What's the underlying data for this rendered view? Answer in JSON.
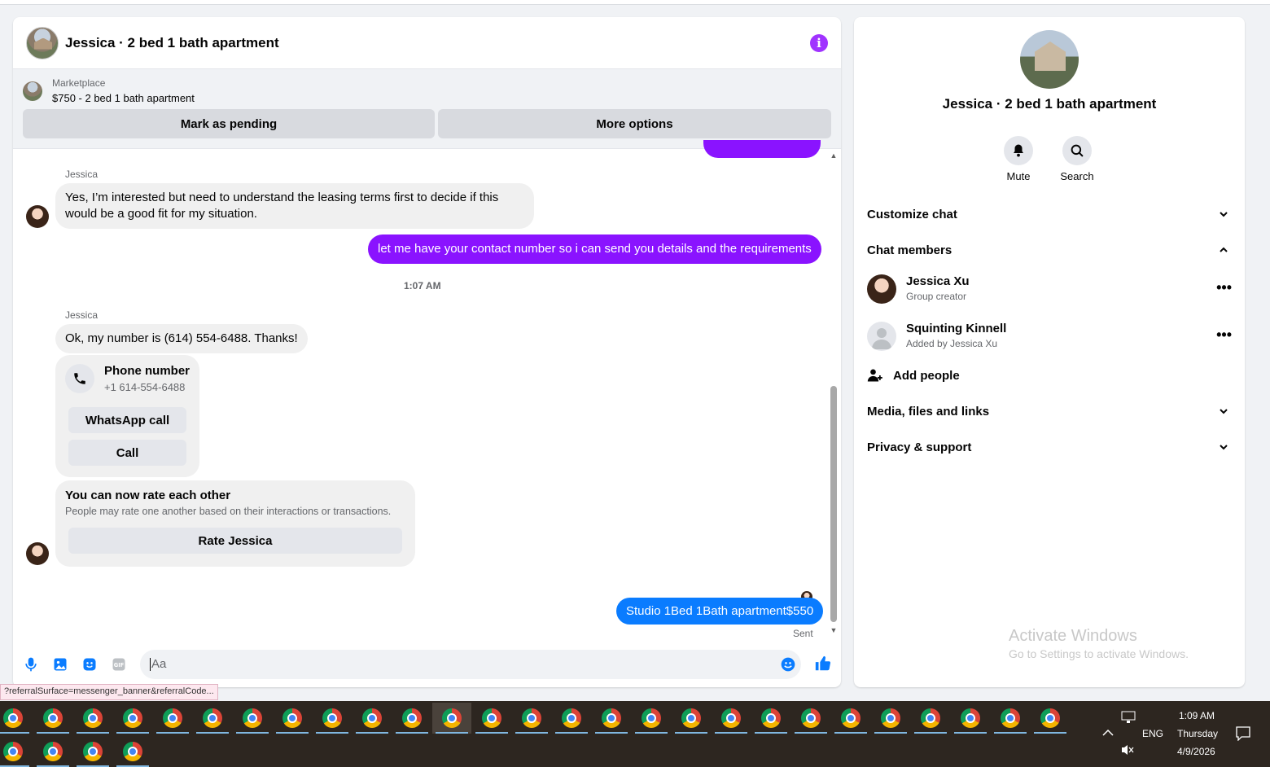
{
  "chat": {
    "title": "Jessica · 2 bed 1 bath apartment",
    "marketplace_label": "Marketplace",
    "listing": "$750 - 2 bed 1 bath apartment",
    "btn_pending": "Mark as pending",
    "btn_more": "More options",
    "messages": {
      "m1_sender": "Jessica",
      "m1_text": "Yes, I’m interested but need to understand the leasing terms first to decide if this would be a good fit for my situation.",
      "m2_text": "let me have your contact number so i can send you details and the requirements",
      "time": "1:07 AM",
      "m3_sender": "Jessica",
      "m3_text": "Ok, my number is (614) 554-6488. Thanks!",
      "phone_title": "Phone number",
      "phone_number": "+1 614-554-6488",
      "whatsapp_btn": "WhatsApp call",
      "call_btn": "Call",
      "rate_title": "You can now rate each other",
      "rate_sub": "People may rate one another based on their interactions or transactions.",
      "rate_btn": "Rate Jessica",
      "m4_text": "Studio 1Bed 1Bath apartment$550",
      "status": "Sent"
    },
    "composer_placeholder": "Aa"
  },
  "info": {
    "title": "Jessica · 2 bed 1 bath apartment",
    "mute": "Mute",
    "search": "Search",
    "customize": "Customize chat",
    "members_header": "Chat members",
    "members": [
      {
        "name": "Jessica Xu",
        "sub": "Group creator"
      },
      {
        "name": "Squinting Kinnell",
        "sub": "Added by Jessica Xu"
      }
    ],
    "add_people": "Add people",
    "media": "Media, files and links",
    "privacy": "Privacy & support",
    "watermark_title": "Activate Windows",
    "watermark_sub": "Go to Settings to activate Windows."
  },
  "url_tip": "?referralSurface=messenger_banner&referralCode...",
  "taskbar": {
    "lang": "ENG",
    "time": "1:09 AM",
    "day": "Thursday",
    "date": "4/9/2026"
  },
  "colors": {
    "accent_purple": "#8a13ff",
    "accent_blue": "#0a7cff"
  }
}
